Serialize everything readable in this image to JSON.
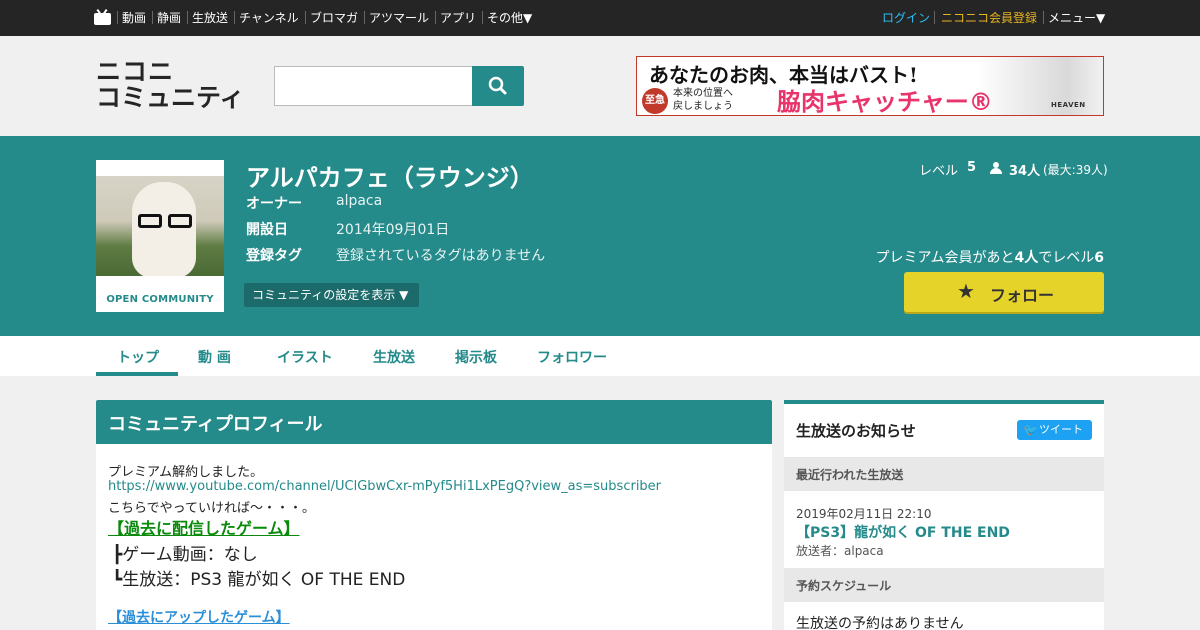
{
  "topnav": {
    "items": [
      "動画",
      "静画",
      "生放送",
      "チャンネル",
      "ブロマガ",
      "アツマール",
      "アプリ",
      "その他▼"
    ],
    "login": "ログイン",
    "register": "ニコニコ会員登録",
    "menu": "メニュー▼"
  },
  "header": {
    "logo_line1": "ニコニ",
    "logo_line2": "コミュニティ",
    "search_placeholder": ""
  },
  "ad": {
    "headline": "あなたのお肉、本当はバスト!",
    "badge": "至急",
    "sub_line1": "本来の位置へ",
    "sub_line2": "戻しましょう",
    "product": "脇肉キャッチャー®",
    "brand": "HEAVEN"
  },
  "community": {
    "thumb_label": "OPEN COMMUNITY",
    "title": "アルパカフェ（ラウンジ）",
    "owner_label": "オーナー",
    "owner_value": "alpaca",
    "opened_label": "開設日",
    "opened_value": "2014年09月01日",
    "tags_label": "登録タグ",
    "tags_value": "登録されているタグはありません",
    "settings_button": "コミュニティの設定を表示 ▼",
    "level_label": "レベル",
    "level_value": "5",
    "members": "34人",
    "members_max": "(最大:39人)",
    "premium_note_pre": "プレミアム会員があと",
    "premium_note_num": "4人",
    "premium_note_mid": "でレベル",
    "premium_note_lvl": "6",
    "follow_button": "フォロー"
  },
  "tabs": [
    "トップ",
    "動 画",
    "イラスト",
    "生放送",
    "掲示板",
    "フォロワー"
  ],
  "profile": {
    "heading": "コミュニティプロフィール",
    "line1": "プレミアム解約しました。",
    "link": "https://www.youtube.com/channel/UClGbwCxr-mPyf5Hi1LxPEgQ?view_as=subscriber",
    "line3": "こちらでやっていければ～・・・。",
    "games_heading": "【過去に配信したゲーム】",
    "games_line1": "┣ゲーム動画：なし",
    "games_line2": "┗生放送：PS3 龍が如く OF THE END",
    "uploads_heading": "【過去にアップしたゲーム】"
  },
  "side": {
    "title": "生放送のお知らせ",
    "tweet": "ツイート",
    "recent_label": "最近行われた生放送",
    "recent_date": "2019年02月11日 22:10",
    "recent_title": "【PS3】龍が如く OF THE END",
    "recent_caster": "放送者：alpaca",
    "schedule_label": "予約スケジュール",
    "schedule_none": "生放送の予約はありません"
  }
}
